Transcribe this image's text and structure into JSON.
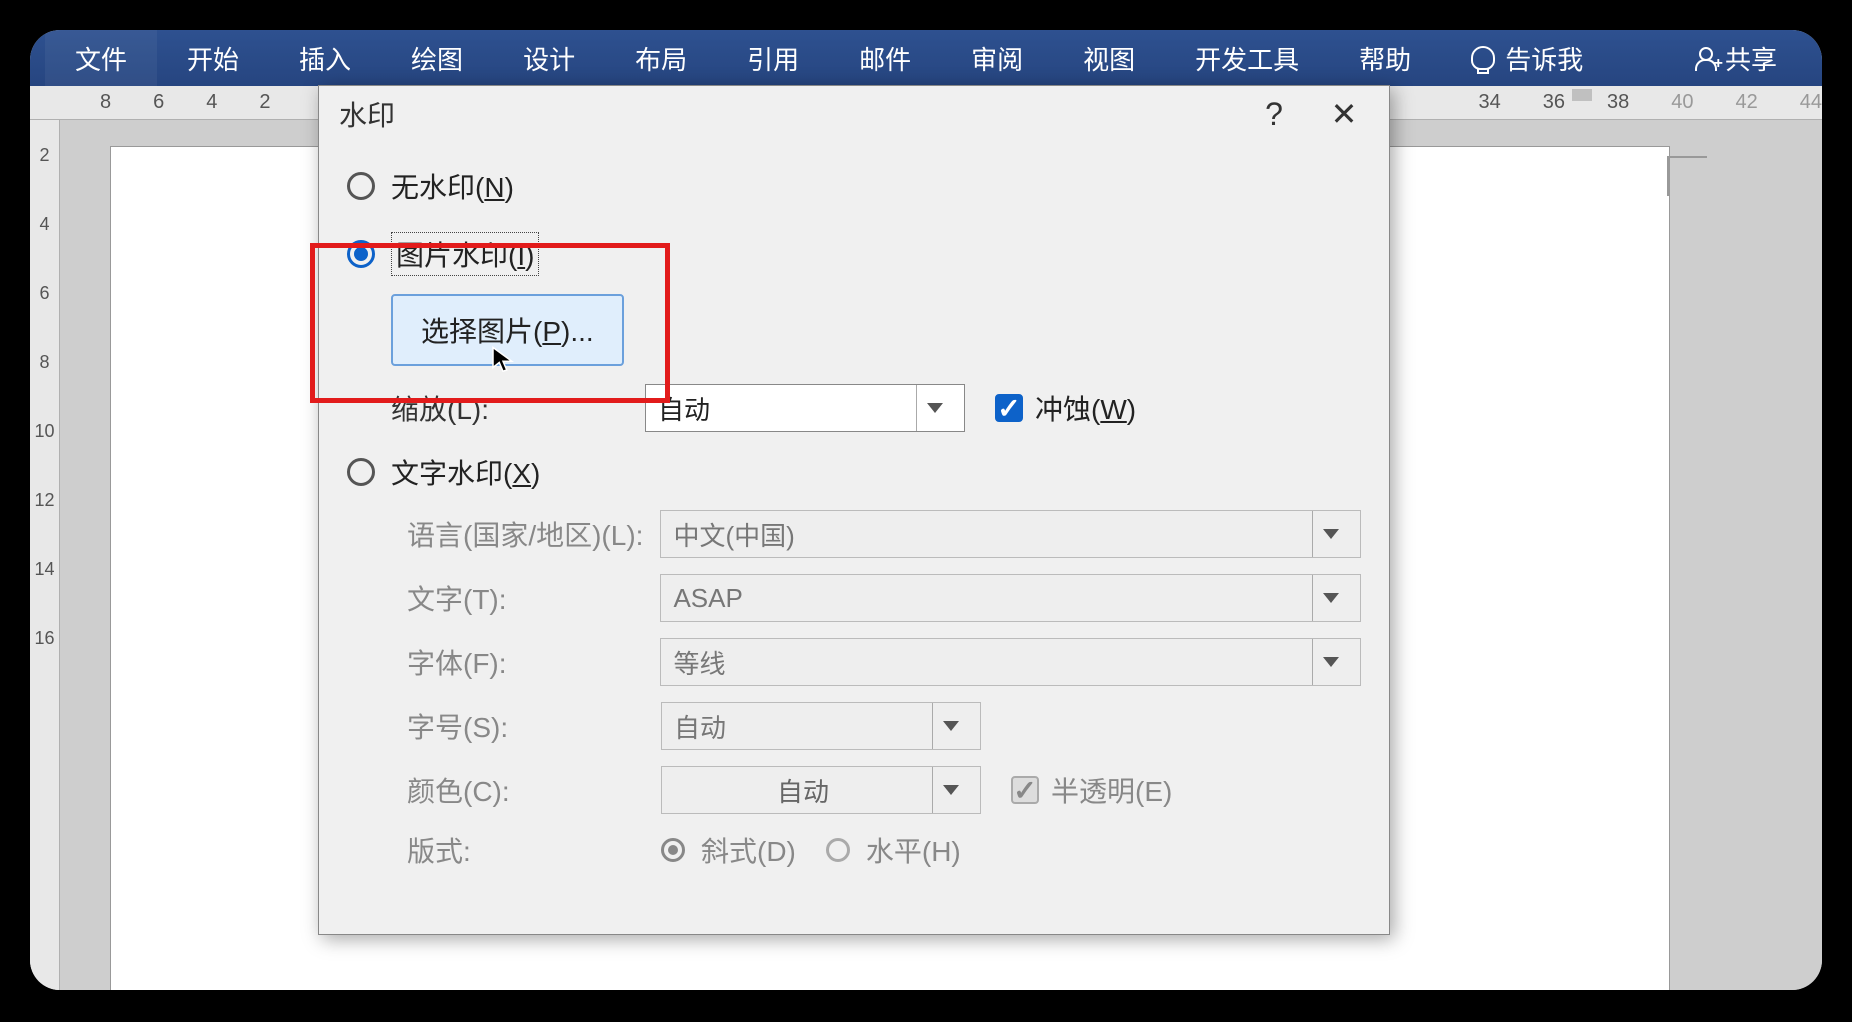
{
  "ribbon": {
    "tabs": {
      "file": "文件",
      "home": "开始",
      "insert": "插入",
      "draw": "绘图",
      "design": "设计",
      "layout": "布局",
      "references": "引用",
      "mailings": "邮件",
      "review": "审阅",
      "view": "视图",
      "developer": "开发工具",
      "help": "帮助"
    },
    "tell_me": "告诉我",
    "share": "共享"
  },
  "ruler_h": [
    "8",
    "6",
    "4",
    "2",
    "34",
    "36",
    "38",
    "40",
    "42",
    "44"
  ],
  "ruler_v": [
    "2",
    "4",
    "6",
    "8",
    "10",
    "12",
    "14",
    "16"
  ],
  "dialog": {
    "title": "水印",
    "help": "?",
    "close": "✕",
    "no_watermark": "无水印",
    "no_watermark_key": "N",
    "picture_watermark": "图片水印",
    "picture_watermark_key": "I",
    "select_picture_btn": "选择图片",
    "select_picture_key": "P",
    "select_picture_suffix": "...",
    "scale_label": "缩放(L):",
    "scale_value": "自动",
    "washout_label": "冲蚀",
    "washout_key": "W",
    "text_watermark": "文字水印",
    "text_watermark_key": "X",
    "language_label": "语言(国家/地区)(L):",
    "language_value": "中文(中国)",
    "text_label": "文字(T):",
    "text_value": "ASAP",
    "font_label": "字体(F):",
    "font_value": "等线",
    "size_label": "字号(S):",
    "size_value": "自动",
    "color_label": "颜色(C):",
    "color_value": "自动",
    "semitransparent_label": "半透明(E)",
    "layout_label": "版式:",
    "diagonal_label": "斜式(D)",
    "horizontal_label": "水平(H)"
  }
}
